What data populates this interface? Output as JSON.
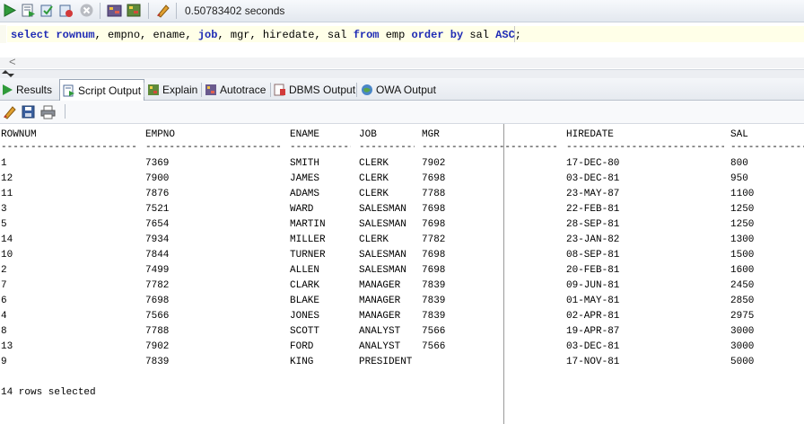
{
  "toolbar": {
    "timing": "0.50783402 seconds",
    "icons": [
      "run-statement-icon",
      "run-script-icon",
      "commit-icon",
      "rollback-icon",
      "cancel-icon",
      "autotrace-icon",
      "explain-plan-icon",
      "clear-icon"
    ]
  },
  "editor": {
    "tokens": [
      {
        "t": "select",
        "k": true
      },
      {
        "t": " ",
        "k": false
      },
      {
        "t": "rownum",
        "k": true
      },
      {
        "t": ", empno, ename, ",
        "k": false
      },
      {
        "t": "job",
        "k": true
      },
      {
        "t": ", mgr, hiredate, sal ",
        "k": false
      },
      {
        "t": "from",
        "k": true
      },
      {
        "t": " emp ",
        "k": false
      },
      {
        "t": "order",
        "k": true
      },
      {
        "t": " ",
        "k": false
      },
      {
        "t": "by",
        "k": true
      },
      {
        "t": " sal ",
        "k": false
      },
      {
        "t": "ASC",
        "k": true
      },
      {
        "t": ";",
        "k": false
      }
    ],
    "scroll_left": "<"
  },
  "tabs": [
    {
      "label": "Results",
      "icon": "results-icon"
    },
    {
      "label": "Script Output",
      "icon": "script-output-icon",
      "active": true
    },
    {
      "label": "Explain",
      "icon": "explain-icon"
    },
    {
      "label": "Autotrace",
      "icon": "autotrace-icon"
    },
    {
      "label": "DBMS Output",
      "icon": "dbms-output-icon"
    },
    {
      "label": "OWA Output",
      "icon": "owa-output-icon"
    }
  ],
  "output": {
    "headers": [
      "ROWNUM",
      "EMPNO",
      "ENAME",
      "JOB",
      "MGR",
      "HIREDATE",
      "SAL"
    ],
    "rows": [
      [
        "1",
        "7369",
        "SMITH",
        "CLERK",
        "7902",
        "17-DEC-80",
        "800"
      ],
      [
        "12",
        "7900",
        "JAMES",
        "CLERK",
        "7698",
        "03-DEC-81",
        "950"
      ],
      [
        "11",
        "7876",
        "ADAMS",
        "CLERK",
        "7788",
        "23-MAY-87",
        "1100"
      ],
      [
        "3",
        "7521",
        "WARD",
        "SALESMAN",
        "7698",
        "22-FEB-81",
        "1250"
      ],
      [
        "5",
        "7654",
        "MARTIN",
        "SALESMAN",
        "7698",
        "28-SEP-81",
        "1250"
      ],
      [
        "14",
        "7934",
        "MILLER",
        "CLERK",
        "7782",
        "23-JAN-82",
        "1300"
      ],
      [
        "10",
        "7844",
        "TURNER",
        "SALESMAN",
        "7698",
        "08-SEP-81",
        "1500"
      ],
      [
        "2",
        "7499",
        "ALLEN",
        "SALESMAN",
        "7698",
        "20-FEB-81",
        "1600"
      ],
      [
        "7",
        "7782",
        "CLARK",
        "MANAGER",
        "7839",
        "09-JUN-81",
        "2450"
      ],
      [
        "6",
        "7698",
        "BLAKE",
        "MANAGER",
        "7839",
        "01-MAY-81",
        "2850"
      ],
      [
        "4",
        "7566",
        "JONES",
        "MANAGER",
        "7839",
        "02-APR-81",
        "2975"
      ],
      [
        "8",
        "7788",
        "SCOTT",
        "ANALYST",
        "7566",
        "19-APR-87",
        "3000"
      ],
      [
        "13",
        "7902",
        "FORD",
        "ANALYST",
        "7566",
        "03-DEC-81",
        "3000"
      ],
      [
        "9",
        "7839",
        "KING",
        "PRESIDENT",
        "",
        "17-NOV-81",
        "5000"
      ]
    ],
    "footer": "14 rows selected"
  }
}
